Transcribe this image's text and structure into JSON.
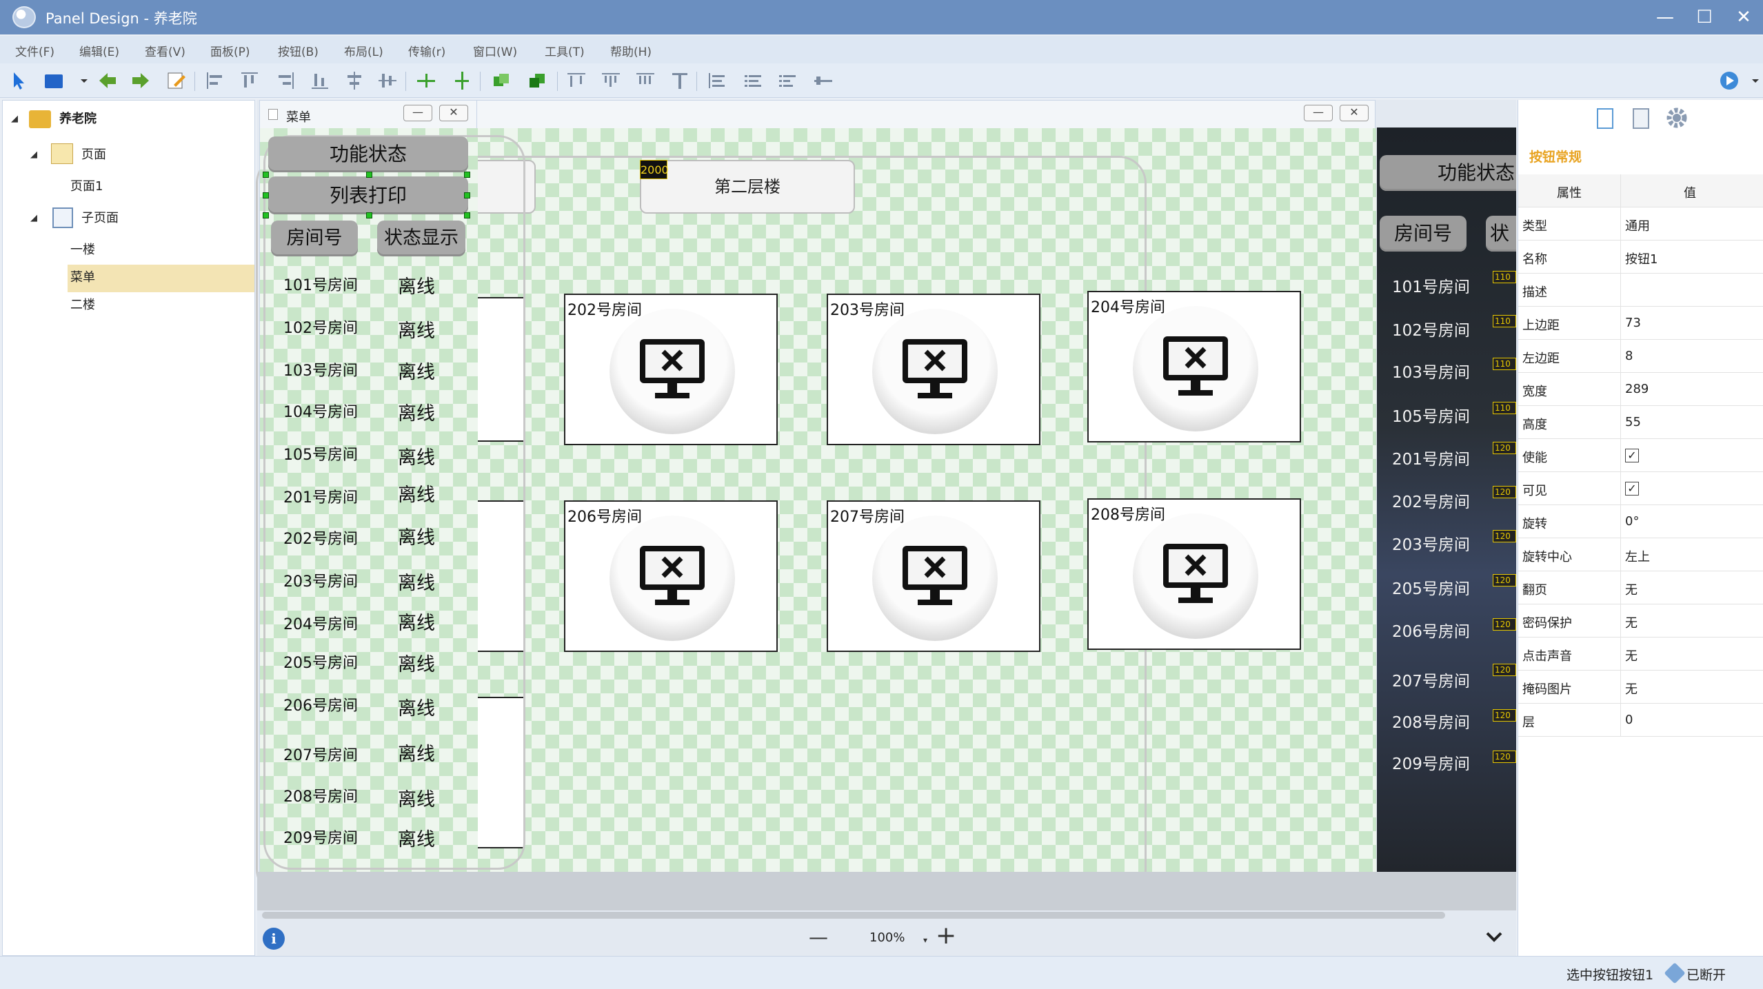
{
  "window": {
    "title": "Panel Design - 养老院",
    "min": "—",
    "max": "☐",
    "close": "✕"
  },
  "menu": [
    "文件(F)",
    "编辑(E)",
    "查看(V)",
    "面板(P)",
    "按钮(B)",
    "布局(L)",
    "传输(r)",
    "窗口(W)",
    "工具(T)",
    "帮助(H)"
  ],
  "tree": {
    "root": "养老院",
    "pages_group": "页面",
    "page1": "页面1",
    "subpages_group": "子页面",
    "sub_first": "一楼",
    "sub_menu": "菜单",
    "sub_second": "二楼"
  },
  "menu_window": {
    "title": "菜单",
    "btn_status": "功能状态",
    "btn_print": "列表打印",
    "hdr_room": "房间号",
    "hdr_status": "状态显示",
    "rows": [
      {
        "room": "101号房间",
        "status": "离线"
      },
      {
        "room": "102号房间",
        "status": "离线"
      },
      {
        "room": "103号房间",
        "status": "离线"
      },
      {
        "room": "104号房间",
        "status": "离线"
      },
      {
        "room": "105号房间",
        "status": "离线"
      },
      {
        "room": "201号房间",
        "status": "离线"
      },
      {
        "room": "202号房间",
        "status": "离线"
      },
      {
        "room": "203号房间",
        "status": "离线"
      },
      {
        "room": "204号房间",
        "status": "离线"
      },
      {
        "room": "205号房间",
        "status": "离线"
      },
      {
        "room": "206号房间",
        "status": "离线"
      },
      {
        "room": "207号房间",
        "status": "离线"
      },
      {
        "room": "208号房间",
        "status": "离线"
      },
      {
        "room": "209号房间",
        "status": "离线"
      }
    ]
  },
  "page_window": {
    "floor_button": "第二层楼",
    "floor_badge": "2000",
    "rooms_top": [
      "202号房间",
      "203号房间",
      "204号房间"
    ],
    "rooms_bottom": [
      "206号房间",
      "207号房间",
      "208号房间"
    ]
  },
  "preview": {
    "btn_status": "功能状态",
    "hdr_room": "房间号",
    "hdr_status": "状",
    "rooms": [
      "101号房间",
      "102号房间",
      "103号房间",
      "105号房间",
      "201号房间",
      "202号房间",
      "203号房间",
      "205号房间",
      "206号房间",
      "207号房间",
      "208号房间",
      "209号房间"
    ],
    "badges": [
      "110",
      "110",
      "110",
      "110",
      "120",
      "120",
      "120",
      "120",
      "120",
      "120",
      "120",
      "120"
    ]
  },
  "zoom": {
    "value": "100%",
    "minus": "—",
    "plus": "+"
  },
  "properties": {
    "section": "按钮常规",
    "col_key": "属性",
    "col_val": "值",
    "rows": [
      {
        "key": "类型",
        "val": "通用"
      },
      {
        "key": "名称",
        "val": "按钮1"
      },
      {
        "key": "描述",
        "val": ""
      },
      {
        "key": "上边距",
        "val": "73"
      },
      {
        "key": "左边距",
        "val": "8"
      },
      {
        "key": "宽度",
        "val": "289"
      },
      {
        "key": "高度",
        "val": "55"
      },
      {
        "key": "使能",
        "val": "✓"
      },
      {
        "key": "可见",
        "val": "✓"
      },
      {
        "key": "旋转",
        "val": "0°"
      },
      {
        "key": "旋转中心",
        "val": "左上"
      },
      {
        "key": "翻页",
        "val": "无"
      },
      {
        "key": "密码保护",
        "val": "无"
      },
      {
        "key": "点击声音",
        "val": "无"
      },
      {
        "key": "掩码图片",
        "val": "无"
      },
      {
        "key": "层",
        "val": "0"
      }
    ]
  },
  "status": {
    "selected": "选中按钮按钮1",
    "connection": "已断开"
  },
  "colors": {
    "titlebar": "#6b8fc0",
    "accent": "#e8a321",
    "selection": "#f3e4b4"
  }
}
